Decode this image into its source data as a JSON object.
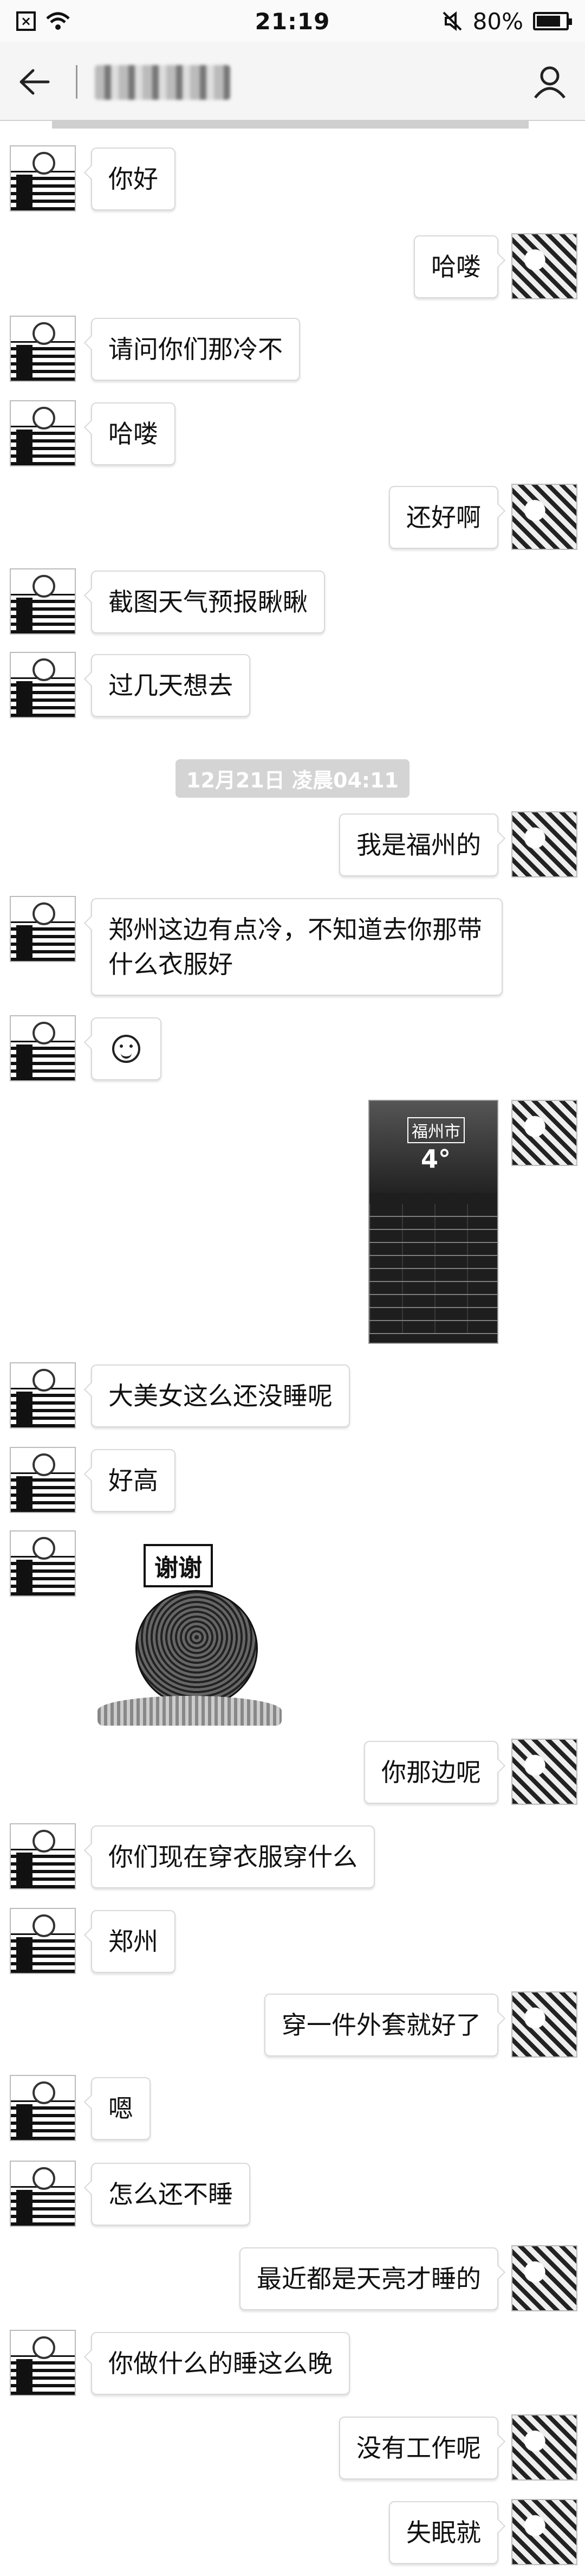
{
  "status_bar": {
    "time": "21:19",
    "battery": "80%",
    "battery_level": 0.8,
    "left_icons": [
      "close-box-icon",
      "wifi-icon"
    ],
    "right_icons": [
      "mute-icon",
      "battery-icon"
    ]
  },
  "header": {
    "back_icon": "back-arrow-icon",
    "profile_icon": "profile-icon"
  },
  "messages": [
    {
      "side": "left",
      "text": "你好"
    },
    {
      "side": "right",
      "text": "哈喽"
    },
    {
      "side": "left",
      "text": "请问你们那冷不"
    },
    {
      "side": "left",
      "text": "哈喽"
    },
    {
      "side": "right",
      "text": "还好啊"
    },
    {
      "side": "left",
      "text": "截图天气预报瞅瞅"
    },
    {
      "side": "left",
      "text": "过几天想去"
    },
    {
      "side": "right",
      "text": "我是福州的"
    },
    {
      "side": "left",
      "text": "郑州这边有点冷，不知道去你那带什么衣服好"
    },
    {
      "side": "left",
      "type": "emoji",
      "icon": "smiley-icon"
    },
    {
      "side": "right",
      "type": "image",
      "city": "福州市",
      "temp": "4°"
    },
    {
      "side": "left",
      "text": "大美女这么还没睡呢"
    },
    {
      "side": "left",
      "text": "好高"
    },
    {
      "side": "left",
      "type": "sticker",
      "text": "谢谢"
    },
    {
      "side": "right",
      "text": "你那边呢"
    },
    {
      "side": "left",
      "text": "你们现在穿衣服穿什么"
    },
    {
      "side": "left",
      "text": "郑州"
    },
    {
      "side": "right",
      "text": "穿一件外套就好了"
    },
    {
      "side": "left",
      "text": "嗯"
    },
    {
      "side": "left",
      "text": "怎么还不睡"
    },
    {
      "side": "right",
      "text": "最近都是天亮才睡的"
    },
    {
      "side": "left",
      "text": "你做什么的睡这么晚"
    },
    {
      "side": "right",
      "text": "没有工作呢"
    },
    {
      "side": "right",
      "text": "失眠就"
    }
  ],
  "timestamp": "12月21日 凌晨04:11"
}
